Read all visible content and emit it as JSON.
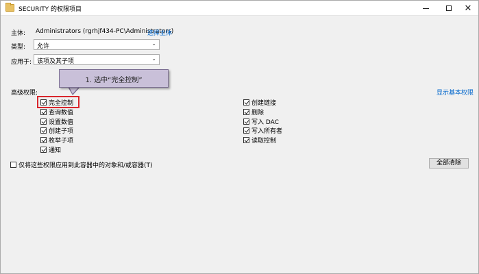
{
  "window": {
    "title": "SECURITY 的权限项目",
    "icon": "folder-icon"
  },
  "principal": {
    "label": "主体:",
    "value": "Administrators (rgrhjf434-PC\\Administrators)",
    "link": "选择主体"
  },
  "type": {
    "label": "类型:",
    "value": "允许"
  },
  "applies_to": {
    "label": "应用于:",
    "value": "该项及其子项"
  },
  "advanced": {
    "label": "高级权限:",
    "show_basic_link": "显示基本权限"
  },
  "permissions_left": [
    {
      "label": "完全控制",
      "checked": true
    },
    {
      "label": "查询数值",
      "checked": true
    },
    {
      "label": "设置数值",
      "checked": true
    },
    {
      "label": "创建子项",
      "checked": true
    },
    {
      "label": "枚举子项",
      "checked": true
    },
    {
      "label": "通知",
      "checked": true
    }
  ],
  "permissions_right": [
    {
      "label": "创建链接",
      "checked": true
    },
    {
      "label": "删除",
      "checked": true
    },
    {
      "label": "写入 DAC",
      "checked": true
    },
    {
      "label": "写入所有者",
      "checked": true
    },
    {
      "label": "读取控制",
      "checked": true
    }
  ],
  "apply_only": {
    "label": "仅将这些权限应用到此容器中的对象和/或容器(T)",
    "checked": false
  },
  "clear_all": "全部清除",
  "callout": {
    "text": "1. 选中“完全控制”",
    "colors": {
      "fill": "#c9c0d9",
      "border": "#7b6e92"
    }
  },
  "highlight_color": "#d9262c"
}
